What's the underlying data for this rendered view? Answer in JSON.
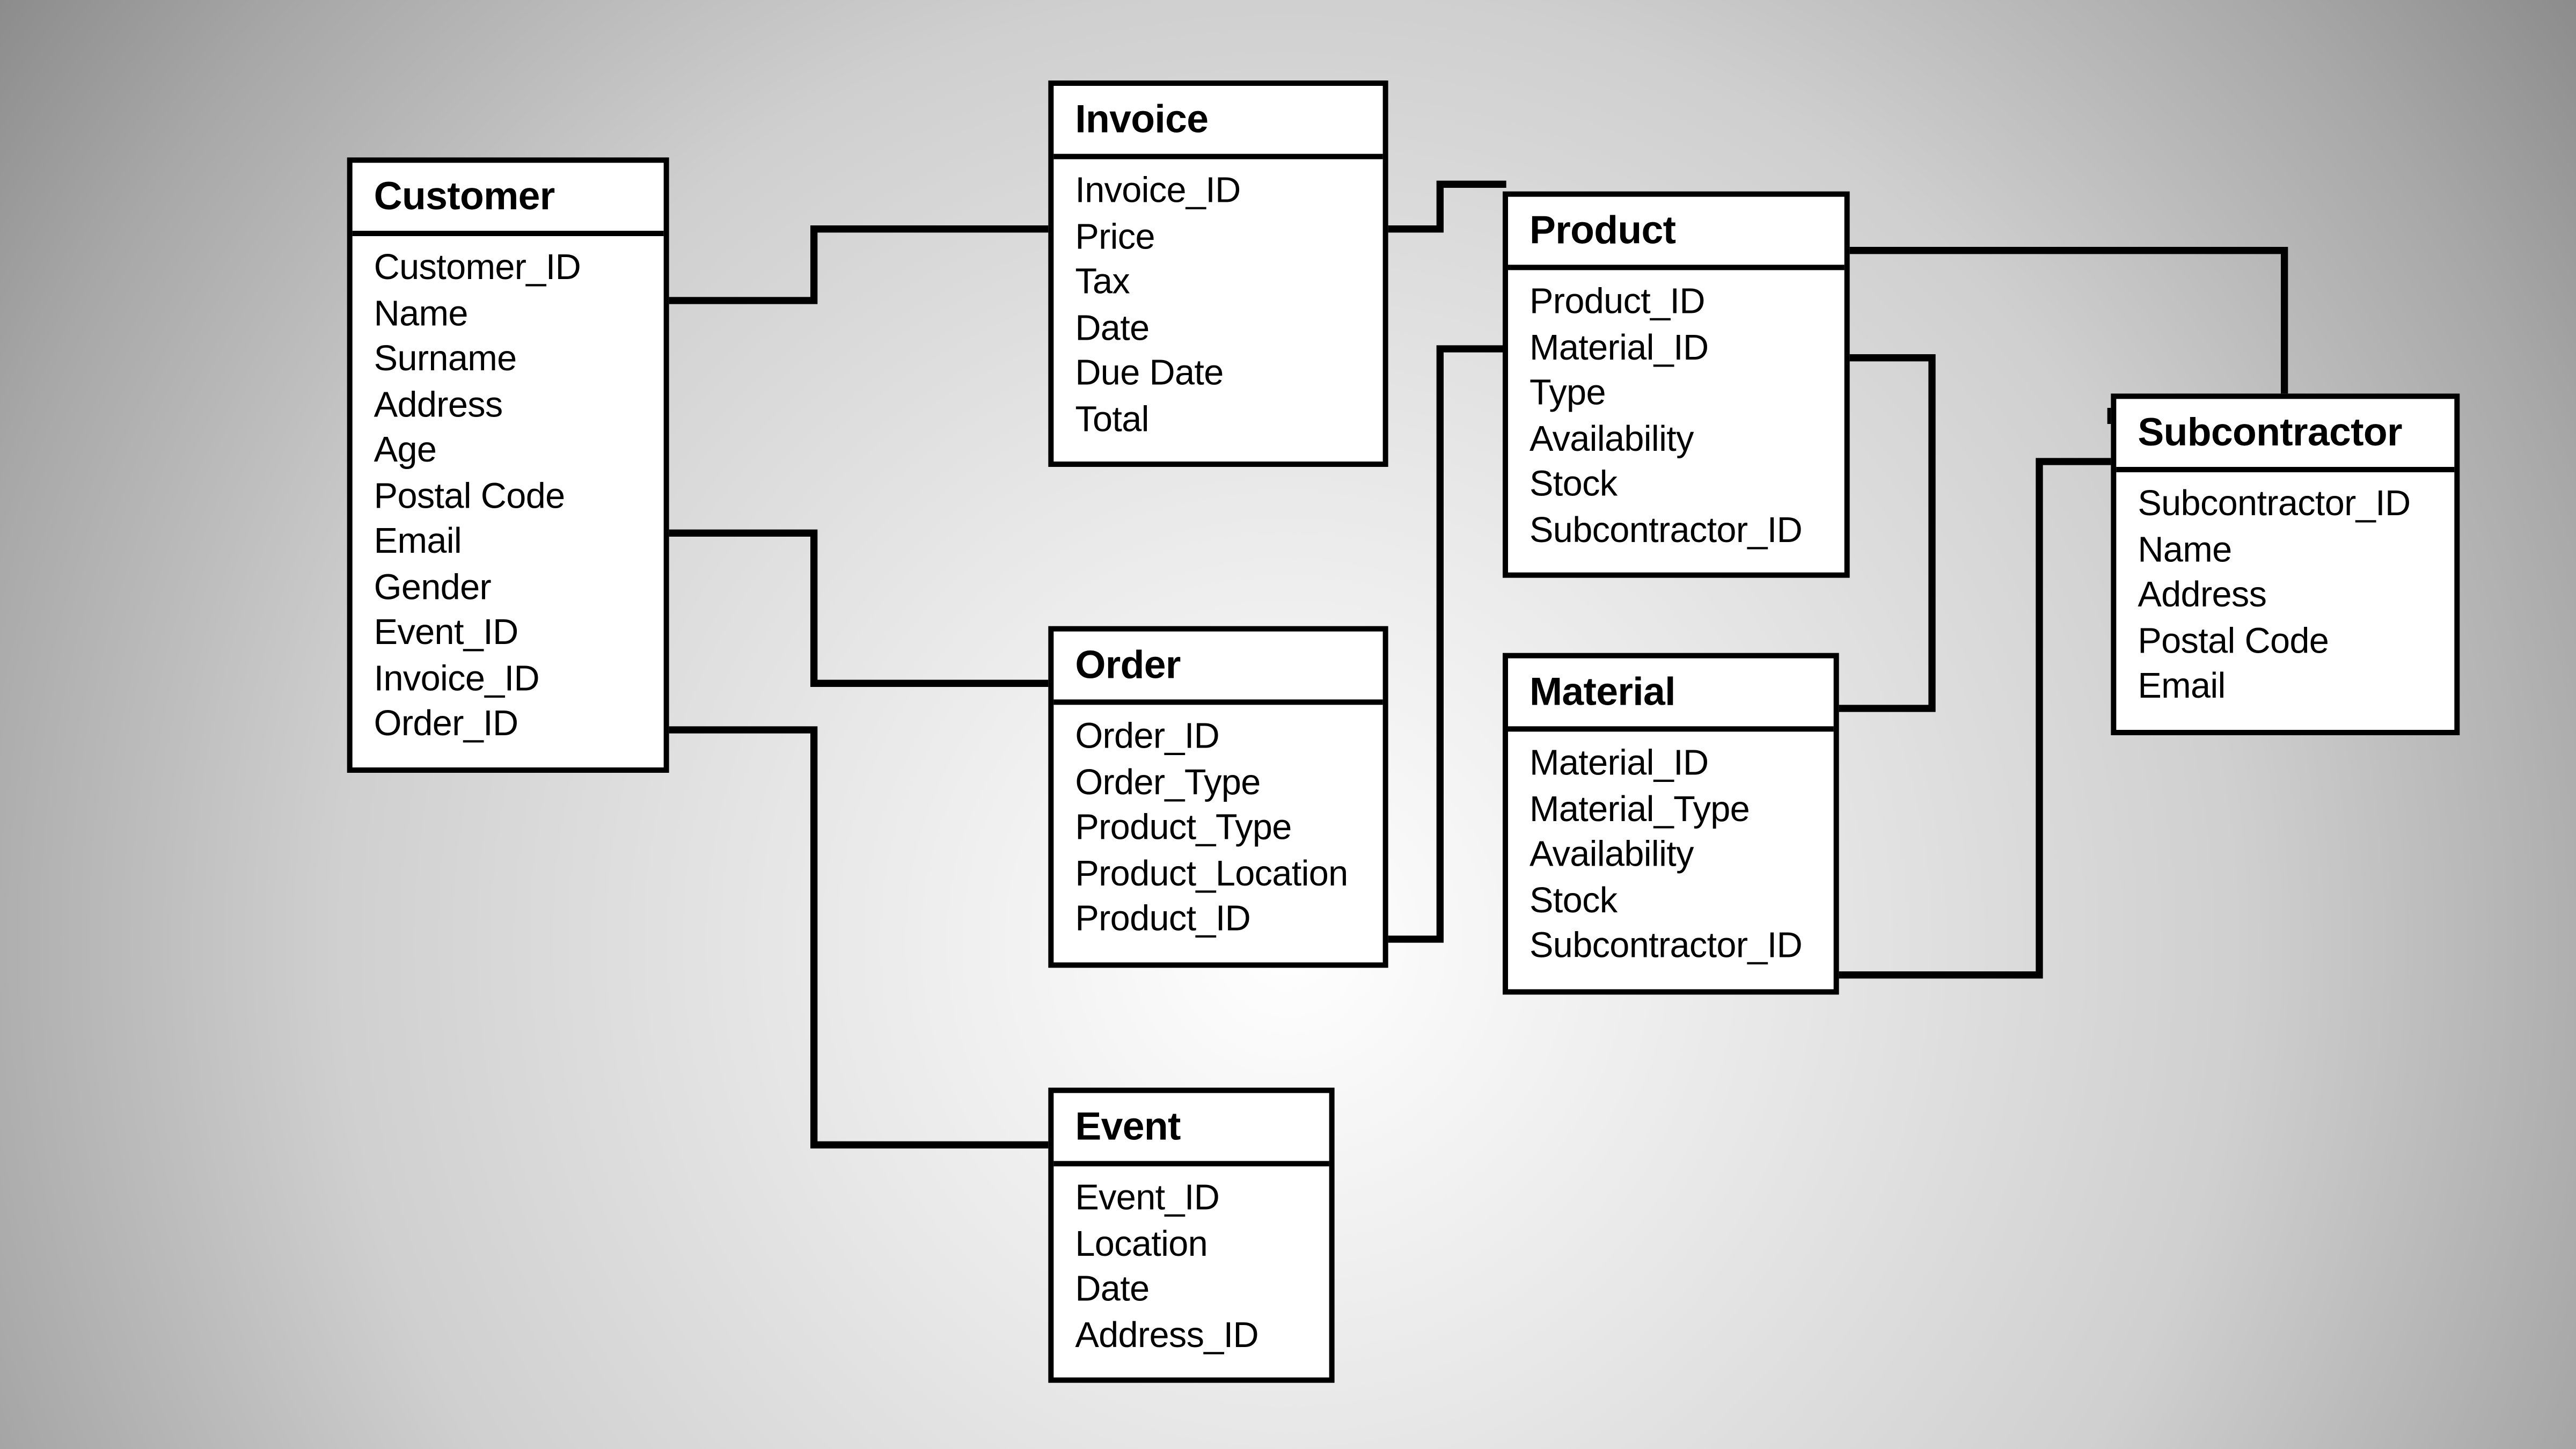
{
  "entities": {
    "customer": {
      "title": "Customer",
      "fields": [
        "Customer_ID",
        "Name",
        "Surname",
        "Address",
        "Age",
        "Postal Code",
        "Email",
        "Gender",
        "Event_ID",
        "Invoice_ID",
        "Order_ID"
      ]
    },
    "invoice": {
      "title": "Invoice",
      "fields": [
        "Invoice_ID",
        "Price",
        "Tax",
        "Date",
        "Due Date",
        "Total"
      ]
    },
    "order": {
      "title": "Order",
      "fields": [
        "Order_ID",
        "Order_Type",
        "Product_Type",
        "Product_Location",
        "Product_ID"
      ]
    },
    "event": {
      "title": "Event",
      "fields": [
        "Event_ID",
        "Location",
        "Date",
        "Address_ID"
      ]
    },
    "product": {
      "title": "Product",
      "fields": [
        "Product_ID",
        "Material_ID",
        "Type",
        "Availability",
        "Stock",
        "Subcontractor_ID"
      ]
    },
    "material": {
      "title": "Material",
      "fields": [
        "Material_ID",
        "Material_Type",
        "Availability",
        "Stock",
        "Subcontractor_ID"
      ]
    },
    "subcontractor": {
      "title": "Subcontractor",
      "fields": [
        "Subcontractor_ID",
        "Name",
        "Address",
        "Postal Code",
        "Email"
      ]
    }
  },
  "connectors": [
    {
      "from": "customer",
      "to": "invoice"
    },
    {
      "from": "customer",
      "to": "order"
    },
    {
      "from": "customer",
      "to": "event"
    },
    {
      "from": "invoice",
      "to": "product"
    },
    {
      "from": "order",
      "to": "product"
    },
    {
      "from": "product",
      "to": "material"
    },
    {
      "from": "product",
      "to": "subcontractor"
    },
    {
      "from": "material",
      "to": "subcontractor"
    }
  ]
}
